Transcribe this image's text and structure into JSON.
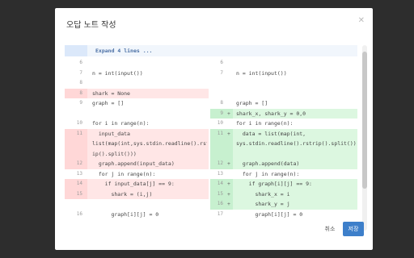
{
  "modal": {
    "title": "오답 노트 작성",
    "close_icon": "close-icon",
    "cancel_label": "취소",
    "save_label": "저장",
    "accent_color": "#3d7fca"
  },
  "diff": {
    "expand_label": "Expand 4 lines ...",
    "rows": [
      {
        "l_num": "6",
        "l_code": "",
        "l_type": "ctx",
        "r_num": "6",
        "r_mark": "",
        "r_code": "",
        "r_type": "ctx"
      },
      {
        "l_num": "7",
        "l_code": "n = int(input())",
        "l_type": "ctx",
        "r_num": "7",
        "r_mark": "",
        "r_code": "n = int(input())",
        "r_type": "ctx"
      },
      {
        "l_num": "8",
        "l_code": "",
        "l_type": "ctx",
        "r_num": "",
        "r_mark": "",
        "r_code": "",
        "r_type": "ctx"
      },
      {
        "l_num": "8",
        "l_code": "shark = None",
        "l_type": "del",
        "r_num": "",
        "r_mark": "",
        "r_code": "",
        "r_type": "empty"
      },
      {
        "l_num": "9",
        "l_code": "graph = []",
        "l_type": "ctx",
        "r_num": "8",
        "r_mark": "",
        "r_code": "graph = []",
        "r_type": "ctx"
      },
      {
        "l_num": "",
        "l_code": "",
        "l_type": "empty",
        "r_num": "9",
        "r_mark": "+",
        "r_code": "shark_x, shark_y = 0,0",
        "r_type": "add"
      },
      {
        "l_num": "10",
        "l_code": "for i in range(n):",
        "l_type": "ctx",
        "r_num": "10",
        "r_mark": "",
        "r_code": "for i in range(n):",
        "r_type": "ctx"
      },
      {
        "l_num": "11",
        "l_code": "  input_data",
        "l_type": "del",
        "r_num": "11",
        "r_mark": "+",
        "r_code": "  data = list(map(int,",
        "r_type": "add"
      },
      {
        "l_num": "",
        "l_code": "list(map(int,sys.stdin.readline().rstr",
        "l_type": "del",
        "r_num": "",
        "r_mark": "",
        "r_code": "sys.stdin.readline().rstrip().split()))",
        "r_type": "add"
      },
      {
        "l_num": "",
        "l_code": "ip().split()))",
        "l_type": "del",
        "r_num": "",
        "r_mark": "",
        "r_code": "",
        "r_type": "add"
      },
      {
        "l_num": "12",
        "l_code": "  graph.append(input_data)",
        "l_type": "del",
        "r_num": "12",
        "r_mark": "+",
        "r_code": "  graph.append(data)",
        "r_type": "add"
      },
      {
        "l_num": "13",
        "l_code": "  for j in range(n):",
        "l_type": "ctx",
        "r_num": "13",
        "r_mark": "",
        "r_code": "  for j in range(n):",
        "r_type": "ctx"
      },
      {
        "l_num": "14",
        "l_code": "    if input_data[j] == 9:",
        "l_type": "del",
        "r_num": "14",
        "r_mark": "+",
        "r_code": "    if graph[i][j] == 9:",
        "r_type": "add"
      },
      {
        "l_num": "15",
        "l_code": "      shark = (i,j)",
        "l_type": "del",
        "r_num": "15",
        "r_mark": "+",
        "r_code": "      shark_x = i",
        "r_type": "add"
      },
      {
        "l_num": "",
        "l_code": "",
        "l_type": "empty",
        "r_num": "16",
        "r_mark": "+",
        "r_code": "      shark_y = j",
        "r_type": "add"
      },
      {
        "l_num": "16",
        "l_code": "      graph[i][j] = 0",
        "l_type": "ctx",
        "r_num": "17",
        "r_mark": "",
        "r_code": "      graph[i][j] = 0",
        "r_type": "ctx"
      },
      {
        "l_num": "",
        "l_code": "",
        "l_type": "ctx",
        "r_num": "",
        "r_mark": "",
        "r_code": "",
        "r_type": "ctx"
      }
    ]
  }
}
